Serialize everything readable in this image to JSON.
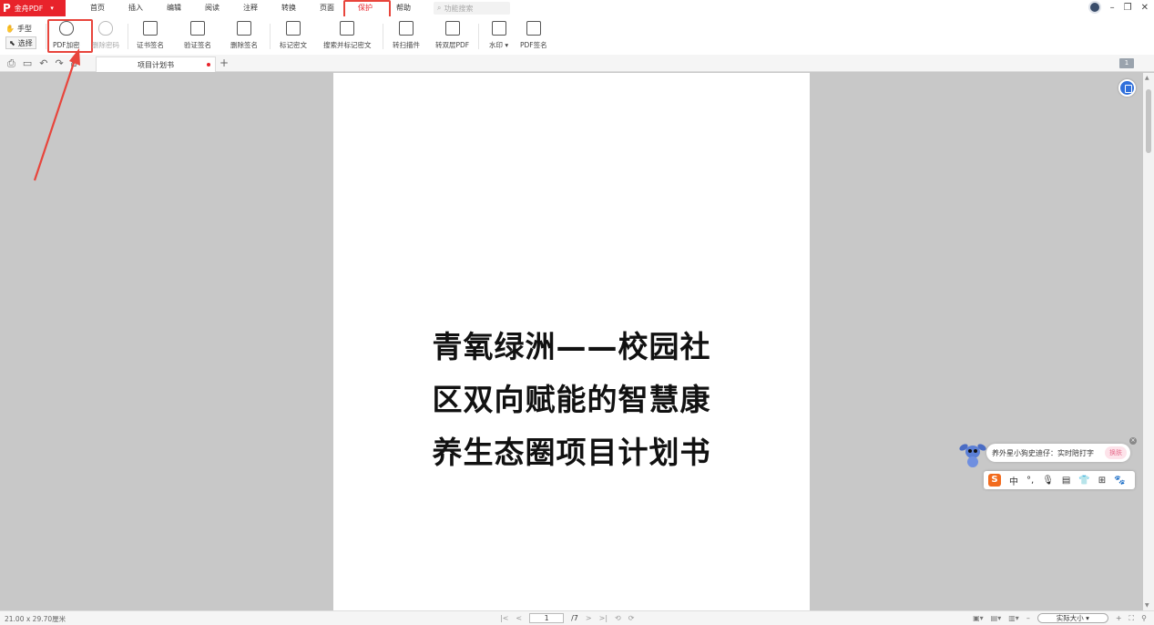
{
  "app": {
    "logo": "P",
    "name": "金舟PDF"
  },
  "menu": [
    "首页",
    "插入",
    "编辑",
    "阅读",
    "注释",
    "转换",
    "页面",
    "保护",
    "帮助"
  ],
  "search": {
    "placeholder": "功能搜索"
  },
  "modes": {
    "hand": "手型",
    "select": "选择"
  },
  "ribbon": {
    "encrypt": "PDF加密",
    "remove_password": "删除密码",
    "cert_sign": "证书签名",
    "verify_sign": "验证签名",
    "delete_sign": "删除签名",
    "mark_redact": "标记密文",
    "search_mark_redact": "搜索并标记密文",
    "scan_plugin": "转扫描件",
    "dual_layer": "转双层PDF",
    "watermark": "水印",
    "pdf_sign": "PDF签名"
  },
  "tab": {
    "title": "项目计划书"
  },
  "page_badge": "1",
  "document": {
    "title_lines": [
      "青氧绿洲——校园社",
      "区双向赋能的智慧康",
      "养生态圈项目计划书"
    ]
  },
  "ime": {
    "message": "养外星小狗史迪仔：实时陪打字",
    "swap": "换肤",
    "toolbar": [
      "S",
      "中",
      "°,",
      "🎙",
      "▤",
      "👕",
      "⊞",
      "🐾"
    ]
  },
  "status": {
    "dimensions": "21.00 x 29.70厘米",
    "current_page": "1",
    "total_pages": "/7",
    "zoom": "实际大小"
  },
  "colors": {
    "accent": "#e8232b",
    "annotation": "#e8453c",
    "float_button": "#2f6fdb"
  }
}
